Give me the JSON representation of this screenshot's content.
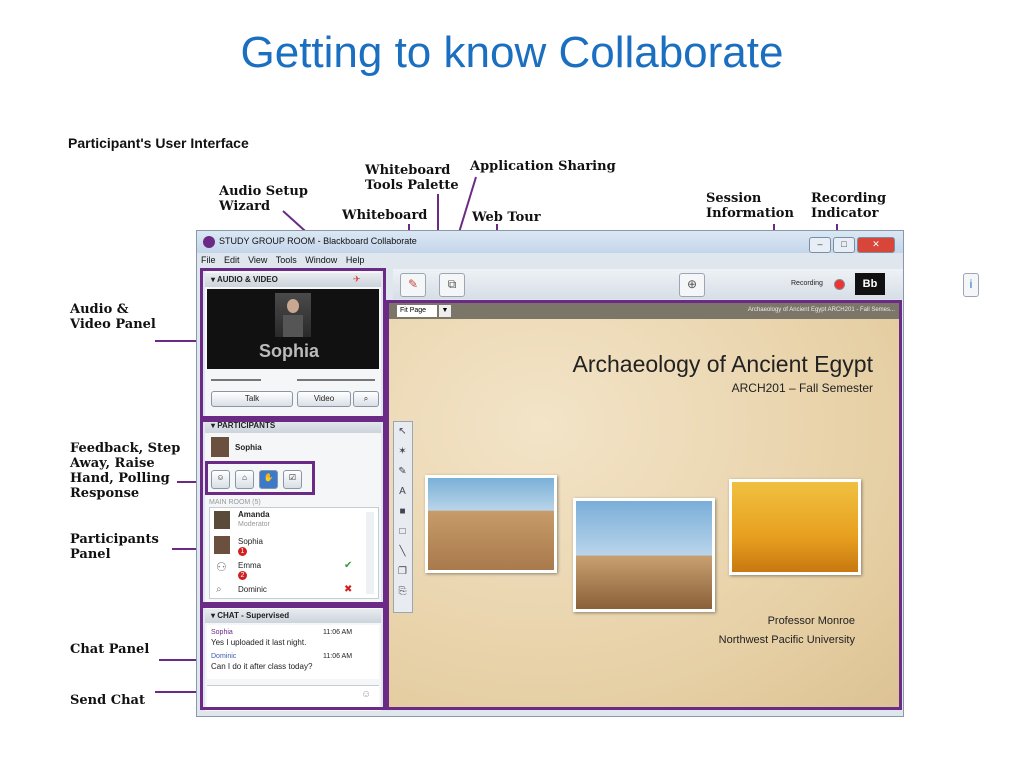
{
  "slide": {
    "title": "Getting to know Collaborate",
    "subtitle": "Participant's User Interface"
  },
  "callouts": {
    "audio_setup": [
      "Audio Setup",
      "Wizard"
    ],
    "whiteboard": "Whiteboard",
    "whiteboard_tools": [
      "Whiteboard",
      "Tools Palette"
    ],
    "app_sharing": "Application Sharing",
    "web_tour": "Web Tour",
    "session_info": [
      "Session",
      "Information"
    ],
    "recording_indicator": [
      "Recording",
      "Indicator"
    ],
    "audio_video_panel": [
      "Audio &",
      "Video Panel"
    ],
    "feedback": [
      "Feedback, Step",
      "Away, Raise",
      "Hand, Polling",
      "Response"
    ],
    "participants_panel": [
      "Participants",
      "Panel"
    ],
    "chat_panel": "Chat Panel",
    "send_chat": "Send Chat"
  },
  "window": {
    "title": "STUDY GROUP ROOM - Blackboard Collaborate",
    "menu": [
      "File",
      "Edit",
      "View",
      "Tools",
      "Window",
      "Help"
    ],
    "recording_label": "Recording",
    "bb_logo": "Bb"
  },
  "audio_video": {
    "header": "AUDIO & VIDEO",
    "speaker_name": "Sophia",
    "talk_label": "Talk",
    "video_label": "Video"
  },
  "participants": {
    "header": "PARTICIPANTS",
    "me": "Sophia",
    "room_label": "MAIN ROOM (5)",
    "list": [
      {
        "name": "Amanda",
        "role": "Moderator"
      },
      {
        "name": "Sophia",
        "badge": "1"
      },
      {
        "name": "Emma",
        "badge": "2"
      },
      {
        "name": "Dominic"
      }
    ]
  },
  "chat": {
    "header": "CHAT - Supervised",
    "messages": [
      {
        "sender": "Sophia",
        "time": "11:06 AM",
        "text": "Yes I uploaded it last night."
      },
      {
        "sender": "Dominic",
        "time": "11:06 AM",
        "text": "Can I do it after class today?"
      }
    ]
  },
  "whiteboard": {
    "fit_label": "Fit Page",
    "page_title": "Archaeology of Ancient Egypt ARCH201 - Fall Semes...",
    "title": "Archaeology of Ancient Egypt",
    "subtitle": "ARCH201 – Fall Semester",
    "professor": "Professor Monroe",
    "university": "Northwest Pacific University"
  },
  "colors": {
    "accent": "#6a2a86",
    "title_blue": "#1a6fc0"
  }
}
